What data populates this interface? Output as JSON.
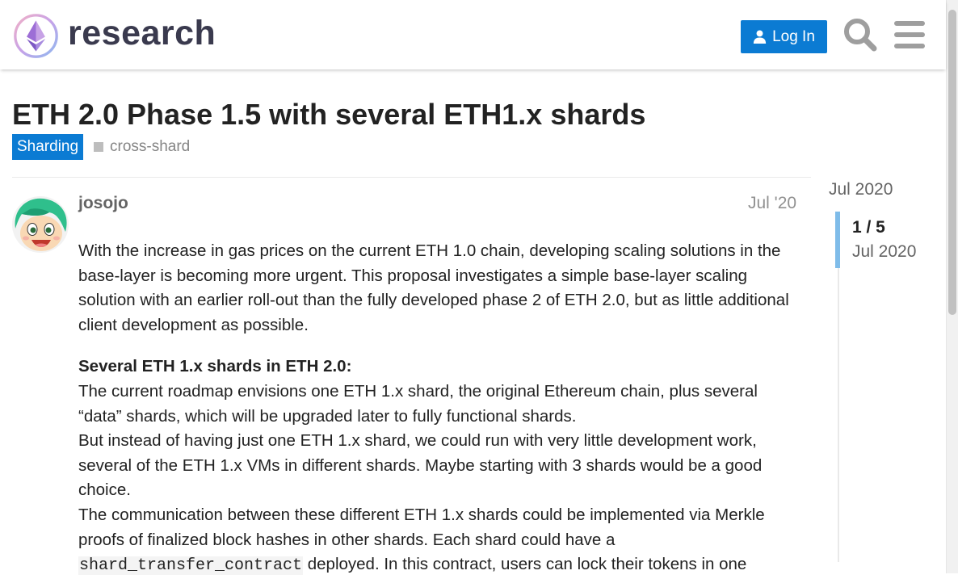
{
  "header": {
    "logo_text": "research",
    "login_label": "Log In"
  },
  "topic": {
    "title": "ETH 2.0 Phase 1.5 with several ETH1.x shards",
    "category": "Sharding",
    "tag": "cross-shard"
  },
  "post": {
    "username": "josojo",
    "date": "Jul '20",
    "p1": "With the increase in gas prices on the current ETH 1.0 chain, developing scaling solutions in the base-layer is becoming more urgent. This proposal investigates a simple base-layer scaling solution with an earlier roll-out than the fully developed phase 2 of ETH 2.0, but as little additional client development as possible.",
    "heading": "Several ETH 1.x shards in ETH 2.0:",
    "p2": "The current roadmap envisions one ETH 1.x shard, the original Ethereum chain, plus several “data” shards, which will be upgraded later to fully functional shards.",
    "p3": "But instead of having just one ETH 1.x shard, we could run with very little development work, several of the ETH 1.x VMs in different shards. Maybe starting with 3 shards would be a good choice.",
    "p4_a": "The communication between these different ETH 1.x shards could be implemented via Merkle proofs of finalized block hashes in other shards. Each shard could have a ",
    "p4_code": "shard_transfer_contract",
    "p4_b": " deployed. In this contract, users can lock their tokens in one"
  },
  "timeline": {
    "top_date": "Jul 2020",
    "position": "1 / 5",
    "current_date": "Jul 2020"
  },
  "colors": {
    "accent": "#0b7bd3",
    "timeline_handle": "#7fbce9"
  },
  "icons": {
    "login": "user-icon",
    "search": "search-icon",
    "menu": "hamburger-menu-icon"
  }
}
